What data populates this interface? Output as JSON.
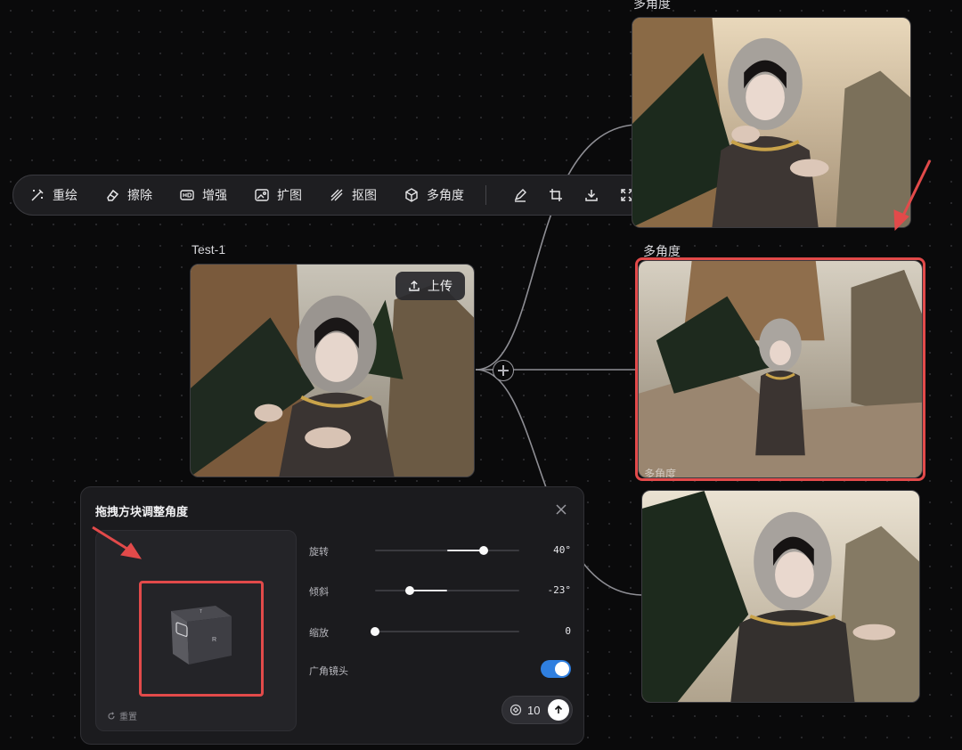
{
  "toolbar": {
    "items": [
      {
        "label": "重绘",
        "icon": "repaint-icon"
      },
      {
        "label": "擦除",
        "icon": "eraser-icon"
      },
      {
        "label": "增强",
        "icon": "hd-enhance-icon"
      },
      {
        "label": "扩图",
        "icon": "expand-image-icon"
      },
      {
        "label": "抠图",
        "icon": "cutout-icon"
      },
      {
        "label": "多角度",
        "icon": "multi-angle-icon"
      }
    ],
    "icon_actions": [
      "brush-icon",
      "crop-icon",
      "download-icon",
      "fullscreen-icon"
    ]
  },
  "source_card": {
    "title": "Test-1",
    "upload_label": "上传"
  },
  "results": [
    {
      "title": "多角度"
    },
    {
      "title": "多角度",
      "selected": true,
      "overlay_label": "多角度"
    },
    {
      "title": ""
    }
  ],
  "panel": {
    "title": "拖拽方块调整角度",
    "reset_label": "重置",
    "controls": [
      {
        "label": "旋转",
        "value": "40°",
        "fraction": 0.75
      },
      {
        "label": "倾斜",
        "value": "-23°",
        "fraction": 0.24
      },
      {
        "label": "缩放",
        "value": "0",
        "fraction": 0.0
      }
    ],
    "toggle": {
      "label": "广角镜头",
      "on": true
    },
    "generate": {
      "count": "10"
    }
  },
  "colors": {
    "accent_blue": "#2f7fe0",
    "annotation_red": "#e24a4a",
    "panel_bg": "#1b1b1e"
  }
}
